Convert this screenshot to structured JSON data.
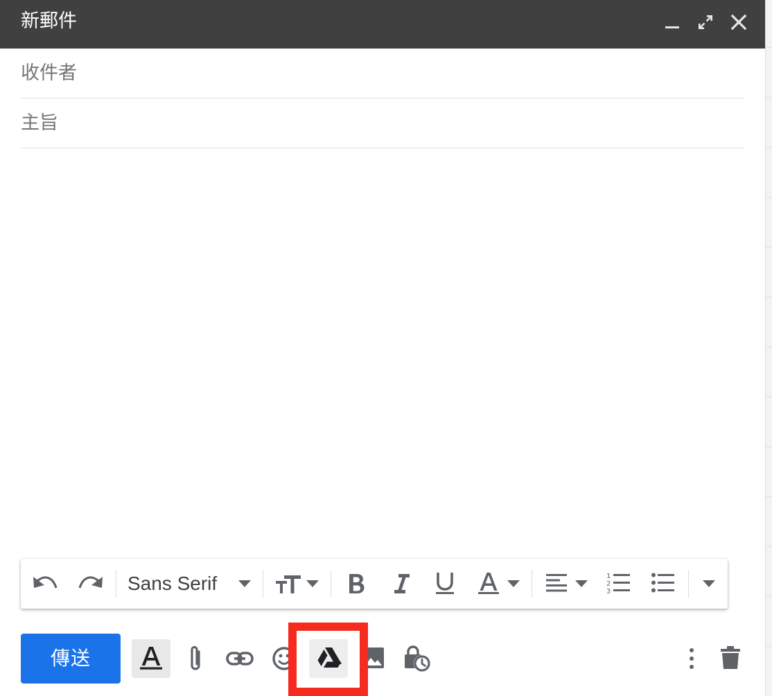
{
  "window": {
    "title": "新郵件"
  },
  "fields": {
    "to_placeholder": "收件者",
    "subject_placeholder": "主旨"
  },
  "formatting_toolbar": {
    "font_family": "Sans Serif",
    "icons": [
      "undo-icon",
      "redo-icon",
      "font-size-icon",
      "bold-icon",
      "italic-icon",
      "underline-icon",
      "text-color-icon",
      "align-icon",
      "numbered-list-icon",
      "bulleted-list-icon",
      "more-formatting-icon"
    ]
  },
  "bottom_toolbar": {
    "send_label": "傳送",
    "icons": [
      "formatting-options-icon",
      "attach-file-icon",
      "insert-link-icon",
      "insert-emoji-icon",
      "google-drive-icon",
      "insert-photo-icon",
      "confidential-mode-icon",
      "more-options-icon",
      "discard-draft-icon"
    ]
  },
  "colors": {
    "titlebar": "#404040",
    "send_button": "#1a73e8",
    "highlight_box": "#f52b1f",
    "icon": "#5f6368"
  }
}
